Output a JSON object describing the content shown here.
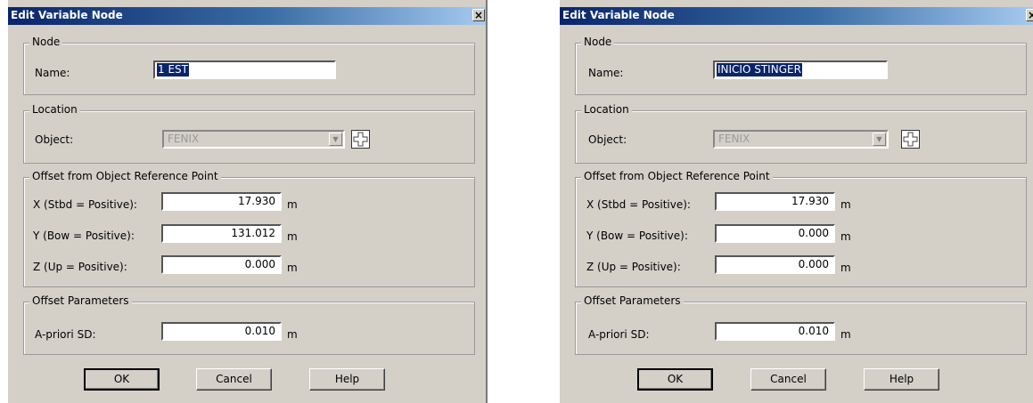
{
  "dialogs": [
    {
      "title": "Edit Variable Node",
      "close_label": "×",
      "node": {
        "legend": "Node",
        "name_label": "Name:",
        "name_value": "1 EST"
      },
      "location": {
        "legend": "Location",
        "object_label": "Object:",
        "object_value": "FENIX",
        "object_disabled": true,
        "dropdown_icon": "combo-arrow-icon",
        "add_icon": "plus-outline-icon"
      },
      "offset": {
        "legend": "Offset from Object Reference Point",
        "x_label": "X  (Stbd = Positive):",
        "x_value": "17.930",
        "y_label": "Y  (Bow = Positive):",
        "y_value": "131.012",
        "z_label": "Z  (Up = Positive):",
        "z_value": "0.000",
        "unit": "m"
      },
      "params": {
        "legend": "Offset Parameters",
        "sd_label": "A-priori SD:",
        "sd_value": "0.010",
        "unit": "m"
      },
      "buttons": {
        "ok": "OK",
        "cancel": "Cancel",
        "help": "Help"
      }
    },
    {
      "title": "Edit Variable Node",
      "close_label": "×",
      "node": {
        "legend": "Node",
        "name_label": "Name:",
        "name_value": "INICIO STINGER"
      },
      "location": {
        "legend": "Location",
        "object_label": "Object:",
        "object_value": "FENIX",
        "object_disabled": true,
        "dropdown_icon": "combo-arrow-icon",
        "add_icon": "plus-outline-icon"
      },
      "offset": {
        "legend": "Offset from Object Reference Point",
        "x_label": "X  (Stbd = Positive):",
        "x_value": "17.930",
        "y_label": "Y  (Bow = Positive):",
        "y_value": "0.000",
        "z_label": "Z  (Up = Positive):",
        "z_value": "0.000",
        "unit": "m"
      },
      "params": {
        "legend": "Offset Parameters",
        "sd_label": "A-priori SD:",
        "sd_value": "0.010",
        "unit": "m"
      },
      "buttons": {
        "ok": "OK",
        "cancel": "Cancel",
        "help": "Help"
      }
    }
  ],
  "colors": {
    "dialog_bg": "#d4d0c8",
    "title_start": "#0a246a",
    "title_end": "#a6caf0",
    "selection": "#0a246a"
  }
}
